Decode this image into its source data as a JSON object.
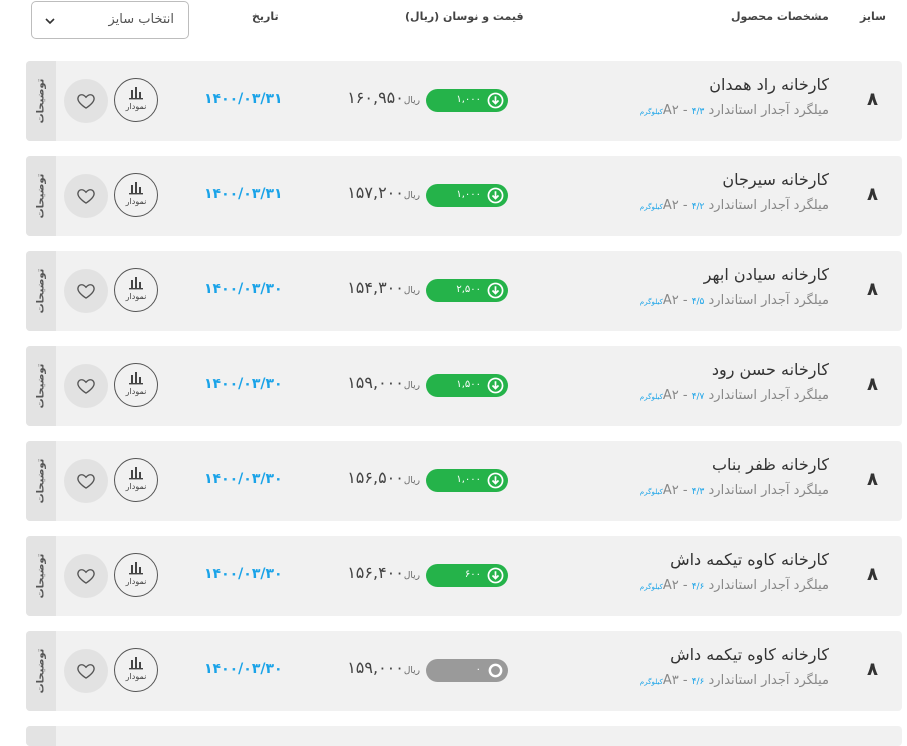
{
  "header": {
    "size_select_label": "انتخاب سایز",
    "col_date": "تاریخ",
    "col_price": "قیمت و نوسان (ریال)",
    "col_specs": "مشخصات محصول",
    "col_size": "سایز"
  },
  "labels": {
    "description": "توضیحات",
    "chart": "نمودار",
    "rial": "ریال",
    "kg": "کیلوگرم"
  },
  "colors": {
    "up": "#25b34a",
    "neutral": "#9a9a9a",
    "accent": "#1aa3e8"
  },
  "rows": [
    {
      "size": "۸",
      "factory": "کارخانه راد همدان",
      "spec": "میلگرد آجدار استاندارد A۲ -",
      "weight": "۴/۳",
      "price": "۱۶۰,۹۵۰",
      "change": "۱,۰۰۰",
      "trend": "up",
      "date": "۱۴۰۰/۰۳/۳۱"
    },
    {
      "size": "۸",
      "factory": "کارخانه سیرجان",
      "spec": "میلگرد آجدار استاندارد A۲ -",
      "weight": "۴/۲",
      "price": "۱۵۷,۲۰۰",
      "change": "۱,۰۰۰",
      "trend": "up",
      "date": "۱۴۰۰/۰۳/۳۱"
    },
    {
      "size": "۸",
      "factory": "کارخانه سیادن ابهر",
      "spec": "میلگرد آجدار استاندارد A۲ -",
      "weight": "۴/۵",
      "price": "۱۵۴,۳۰۰",
      "change": "۲,۵۰۰",
      "trend": "up",
      "date": "۱۴۰۰/۰۳/۳۰"
    },
    {
      "size": "۸",
      "factory": "کارخانه حسن رود",
      "spec": "میلگرد آجدار استاندارد A۲ -",
      "weight": "۴/۷",
      "price": "۱۵۹,۰۰۰",
      "change": "۱,۵۰۰",
      "trend": "up",
      "date": "۱۴۰۰/۰۳/۳۰"
    },
    {
      "size": "۸",
      "factory": "کارخانه ظفر بناب",
      "spec": "میلگرد آجدار استاندارد A۲ -",
      "weight": "۴/۳",
      "price": "۱۵۶,۵۰۰",
      "change": "۱,۰۰۰",
      "trend": "up",
      "date": "۱۴۰۰/۰۳/۳۰"
    },
    {
      "size": "۸",
      "factory": "کارخانه کاوه تیکمه داش",
      "spec": "میلگرد آجدار استاندارد A۲ -",
      "weight": "۴/۶",
      "price": "۱۵۶,۴۰۰",
      "change": "۶۰۰",
      "trend": "up",
      "date": "۱۴۰۰/۰۳/۳۰"
    },
    {
      "size": "۸",
      "factory": "کارخانه کاوه تیکمه داش",
      "spec": "میلگرد آجدار استاندارد A۳ -",
      "weight": "۴/۶",
      "price": "۱۵۹,۰۰۰",
      "change": "۰",
      "trend": "neutral",
      "date": "۱۴۰۰/۰۳/۳۰"
    }
  ]
}
